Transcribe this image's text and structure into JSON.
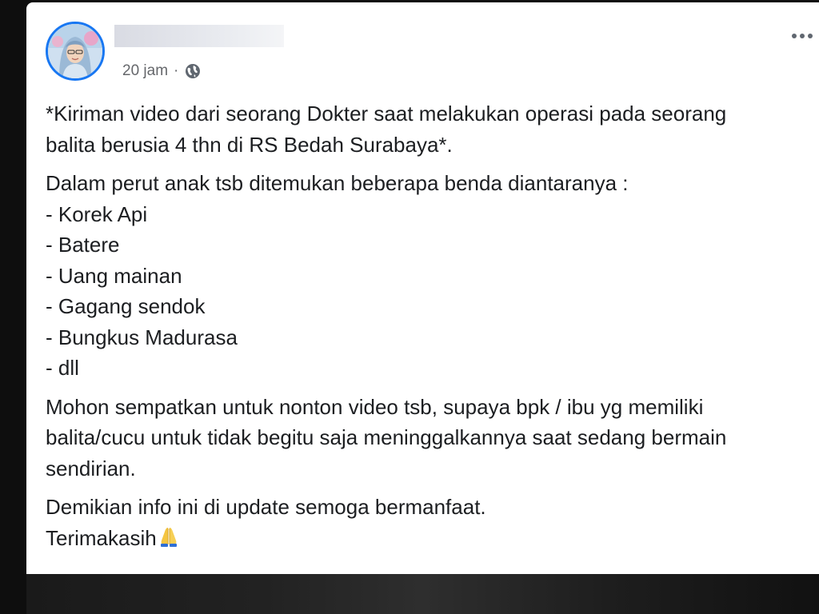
{
  "post": {
    "author_name": "",
    "timestamp": "20 jam",
    "separator": "·",
    "privacy_icon": "globe-icon",
    "more_icon": "more-options-icon",
    "avatar_border_color": "#1877f2",
    "paragraphs": {
      "intro_line1": "*Kiriman video dari seorang Dokter saat melakukan operasi pada seorang",
      "intro_line2": "balita berusia 4 thn di RS Bedah Surabaya*.",
      "list_intro": "Dalam perut anak tsb ditemukan beberapa benda diantaranya :",
      "items": [
        "- Korek Api",
        "- Batere",
        "- Uang mainan",
        "- Gagang sendok",
        "- Bungkus Madurasa",
        "- dll"
      ],
      "appeal_line1": "Mohon sempatkan untuk nonton video tsb, supaya bpk / ibu yg memiliki",
      "appeal_line2": "balita/cucu untuk tidak begitu saja meninggalkannya saat sedang bermain",
      "appeal_line3": "sendirian.",
      "closing_line1": "Demikian info ini di update semoga bermanfaat.",
      "closing_line2": "Terimakasih",
      "closing_emoji_icon": "folded-hands-icon"
    }
  }
}
